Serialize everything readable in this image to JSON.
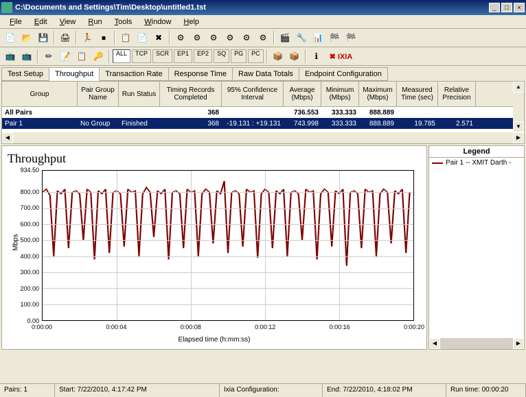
{
  "window": {
    "title": "C:\\Documents and Settings\\Tim\\Desktop\\untitled1.tst"
  },
  "menu": [
    "File",
    "Edit",
    "View",
    "Run",
    "Tools",
    "Window",
    "Help"
  ],
  "filters": [
    "ALL",
    "TCP",
    "SCR",
    "EP1",
    "EP2",
    "SQ",
    "PG",
    "PC"
  ],
  "brand": "IXIA",
  "tabs": {
    "items": [
      "Test Setup",
      "Throughput",
      "Transaction Rate",
      "Response Time",
      "Raw Data Totals",
      "Endpoint Configuration"
    ],
    "active": 1
  },
  "grid": {
    "headers": [
      "Group",
      "Pair Group Name",
      "Run Status",
      "Timing Records Completed",
      "95% Confidence Interval",
      "Average (Mbps)",
      "Minimum (Mbps)",
      "Maximum (Mbps)",
      "Measured Time (sec)",
      "Relative Precision"
    ],
    "rows": [
      {
        "group": "All Pairs",
        "pgname": "",
        "status": "",
        "trc": "368",
        "ci": "",
        "avg": "736.553",
        "min": "333.333",
        "max": "888.889",
        "mt": "",
        "rp": "",
        "bold": true,
        "sel": false
      },
      {
        "group": "Pair 1",
        "pgname": "No Group",
        "status": "Finished",
        "trc": "368",
        "ci": "-19.131 : +19.131",
        "avg": "743.998",
        "min": "333.333",
        "max": "888.889",
        "mt": "19.785",
        "rp": "2.571",
        "bold": false,
        "sel": true
      }
    ]
  },
  "chart": {
    "title": "Throughput",
    "ylabel": "Mbps",
    "xlabel": "Elapsed time (h:mm:ss)",
    "yticks": [
      "934.50",
      "800.00",
      "700.00",
      "600.00",
      "500.00",
      "400.00",
      "300.00",
      "200.00",
      "100.00",
      "0.00"
    ],
    "xticks": [
      "0:00:00",
      "0:00:04",
      "0:00:08",
      "0:00:12",
      "0:00:16",
      "0:00:20"
    ]
  },
  "chart_data": {
    "type": "line",
    "title": "Throughput",
    "xlabel": "Elapsed time (h:mm:ss)",
    "ylabel": "Mbps",
    "ylim": [
      0,
      934.5
    ],
    "xlim_seconds": [
      0,
      20
    ],
    "series": [
      {
        "name": "Pair 1 -- XMIT Darth -",
        "color": "#800000",
        "x_seconds": [
          0.0,
          0.2,
          0.4,
          0.6,
          0.8,
          1.0,
          1.2,
          1.4,
          1.6,
          1.8,
          2.0,
          2.2,
          2.4,
          2.6,
          2.8,
          3.0,
          3.2,
          3.4,
          3.6,
          3.8,
          4.0,
          4.2,
          4.4,
          4.6,
          4.8,
          5.0,
          5.2,
          5.4,
          5.6,
          5.8,
          6.0,
          6.2,
          6.4,
          6.6,
          6.8,
          7.0,
          7.2,
          7.4,
          7.6,
          7.8,
          8.0,
          8.2,
          8.4,
          8.6,
          8.8,
          9.0,
          9.2,
          9.4,
          9.6,
          9.8,
          10.0,
          10.2,
          10.4,
          10.6,
          10.8,
          11.0,
          11.2,
          11.4,
          11.6,
          11.8,
          12.0,
          12.2,
          12.4,
          12.6,
          12.8,
          13.0,
          13.2,
          13.4,
          13.6,
          13.8,
          14.0,
          14.2,
          14.4,
          14.6,
          14.8,
          15.0,
          15.2,
          15.4,
          15.6,
          15.8,
          16.0,
          16.2,
          16.4,
          16.6,
          16.8,
          17.0,
          17.2,
          17.4,
          17.6,
          17.8,
          18.0,
          18.2,
          18.4,
          18.6,
          18.8,
          19.0,
          19.2,
          19.4,
          19.6,
          19.8
        ],
        "y": [
          800,
          820,
          780,
          400,
          810,
          790,
          820,
          450,
          800,
          810,
          790,
          500,
          820,
          800,
          380,
          810,
          790,
          820,
          420,
          800,
          810,
          790,
          460,
          820,
          800,
          810,
          400,
          790,
          830,
          800,
          520,
          810,
          790,
          820,
          380,
          800,
          810,
          790,
          450,
          820,
          800,
          810,
          400,
          790,
          820,
          800,
          480,
          810,
          790,
          870,
          420,
          800,
          810,
          790,
          460,
          820,
          800,
          810,
          390,
          790,
          820,
          800,
          450,
          810,
          790,
          820,
          400,
          800,
          810,
          790,
          500,
          820,
          800,
          810,
          380,
          790,
          820,
          800,
          460,
          810,
          790,
          820,
          340,
          800,
          810,
          790,
          450,
          820,
          800,
          810,
          400,
          790,
          820,
          800,
          480,
          810,
          790,
          820,
          420,
          800
        ]
      }
    ]
  },
  "legend": {
    "title": "Legend",
    "items": [
      "Pair 1 -- XMIT Darth -"
    ]
  },
  "status": {
    "pairs": "Pairs: 1",
    "start": "Start: 7/22/2010, 4:17:42 PM",
    "config": "Ixia Configuration:",
    "end": "End: 7/22/2010, 4:18:02 PM",
    "runtime": "Run time:  00:00:20"
  }
}
